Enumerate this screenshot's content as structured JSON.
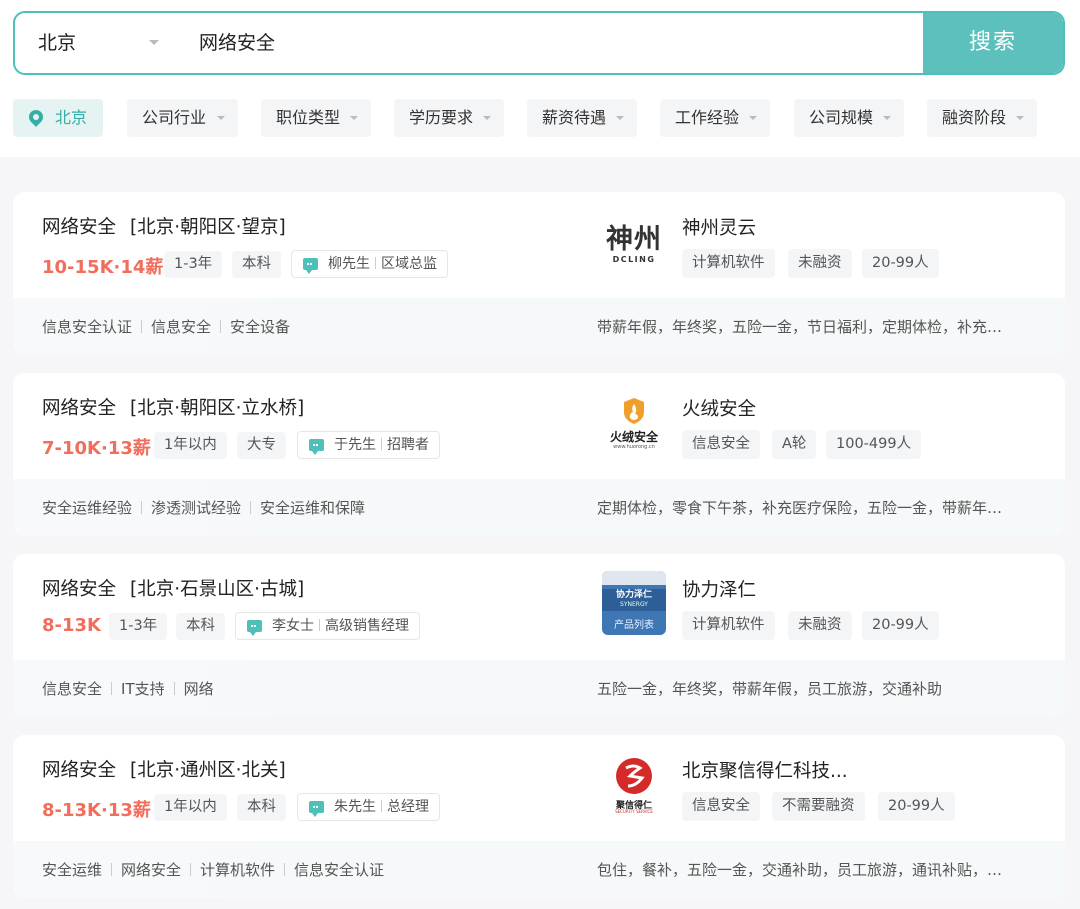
{
  "search": {
    "city": "北京",
    "query": "网络安全",
    "button_label": "搜索"
  },
  "filters": [
    {
      "label": "北京"
    },
    {
      "label": "公司行业"
    },
    {
      "label": "职位类型"
    },
    {
      "label": "学历要求"
    },
    {
      "label": "薪资待遇"
    },
    {
      "label": "工作经验"
    },
    {
      "label": "公司规模"
    },
    {
      "label": "融资阶段"
    }
  ],
  "jobs": [
    {
      "title": "网络安全",
      "area": "[北京·朝阳区·望京]",
      "salary": "10-15K·14薪",
      "experience": "1-3年",
      "education": "本科",
      "recruiter_name": "柳先生",
      "recruiter_role": "区域总监",
      "company": "神州灵云",
      "logo_main": "神州",
      "logo_sub": "DCLING",
      "company_tags": [
        "计算机软件",
        "未融资",
        "20-99人"
      ],
      "skills": [
        "信息安全认证",
        "信息安全",
        "安全设备"
      ],
      "welfare": "带薪年假，年终奖，五险一金，节日福利，定期体检，补充…"
    },
    {
      "title": "网络安全",
      "area": "[北京·朝阳区·立水桥]",
      "salary": "7-10K·13薪",
      "experience": "1年以内",
      "education": "大专",
      "recruiter_name": "于先生",
      "recruiter_role": "招聘者",
      "company": "火绒安全",
      "logo_main": "火绒安全",
      "logo_sub": "www.huorong.cn",
      "company_tags": [
        "信息安全",
        "A轮",
        "100-499人"
      ],
      "skills": [
        "安全运维经验",
        "渗透测试经验",
        "安全运维和保障"
      ],
      "welfare": "定期体检，零食下午茶，补充医疗保险，五险一金，带薪年…"
    },
    {
      "title": "网络安全",
      "area": "[北京·石景山区·古城]",
      "salary": "8-13K",
      "experience": "1-3年",
      "education": "本科",
      "recruiter_name": "李女士",
      "recruiter_role": "高级销售经理",
      "company": "协力泽仁",
      "logo_main": "协力泽仁",
      "logo_sub": "SYNERGY",
      "logo_extra": "产品列表",
      "company_tags": [
        "计算机软件",
        "未融资",
        "20-99人"
      ],
      "skills": [
        "信息安全",
        "IT支持",
        "网络"
      ],
      "welfare": "五险一金，年终奖，带薪年假，员工旅游，交通补助"
    },
    {
      "title": "网络安全",
      "area": "[北京·通州区·北关]",
      "salary": "8-13K·13薪",
      "experience": "1年以内",
      "education": "本科",
      "recruiter_name": "朱先生",
      "recruiter_role": "总经理",
      "company": "北京聚信得仁科技...",
      "logo_main": "聚信得仁",
      "logo_sub": "SECURITY SERVICE",
      "company_tags": [
        "信息安全",
        "不需要融资",
        "20-99人"
      ],
      "skills": [
        "安全运维",
        "网络安全",
        "计算机软件",
        "信息安全认证"
      ],
      "welfare": "包住，餐补，五险一金，交通补助，员工旅游，通讯补贴，…"
    }
  ],
  "colors": {
    "accent": "#4fbfb9",
    "salary": "#f26d5b"
  }
}
